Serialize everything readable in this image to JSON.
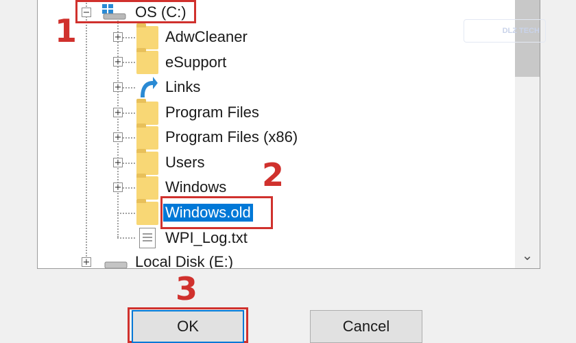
{
  "tree": {
    "root": {
      "label": "OS (C:)",
      "expander": "−"
    },
    "children": [
      {
        "label": "AdwCleaner",
        "icon": "folder-icon",
        "expander": "+"
      },
      {
        "label": "eSupport",
        "icon": "folder-icon",
        "expander": "+"
      },
      {
        "label": "Links",
        "icon": "shortcut-arrow-icon",
        "expander": "+"
      },
      {
        "label": "Program Files",
        "icon": "folder-icon",
        "expander": "+"
      },
      {
        "label": "Program Files (x86)",
        "icon": "folder-icon",
        "expander": "+"
      },
      {
        "label": "Users",
        "icon": "folder-icon",
        "expander": "+"
      },
      {
        "label": "Windows",
        "icon": "folder-icon",
        "expander": "+"
      },
      {
        "label": "Windows.old",
        "icon": "folder-icon",
        "selected": true
      },
      {
        "label": "WPI_Log.txt",
        "icon": "text-file-icon"
      }
    ],
    "next_drive": {
      "label": "Local Disk (E:)",
      "expander": "+"
    }
  },
  "buttons": {
    "ok": "OK",
    "cancel": "Cancel"
  },
  "steps": {
    "one": "1",
    "two": "2",
    "three": "3"
  },
  "watermark": {
    "text": "DLZ TECH"
  },
  "colors": {
    "selection": "#0078d7",
    "callout": "#d0312d",
    "folder": "#f8d775"
  }
}
